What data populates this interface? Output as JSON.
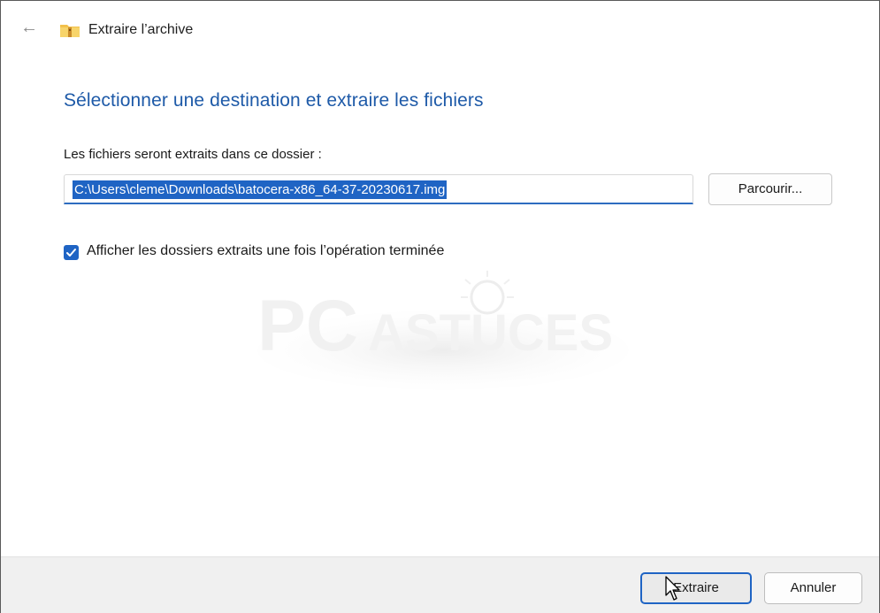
{
  "window": {
    "title": "Extraire l’archive",
    "back_icon": "arrow-left-icon",
    "app_icon": "zip-folder-icon"
  },
  "main": {
    "heading": "Sélectionner une destination et extraire les fichiers",
    "destination_label": "Les fichiers seront extraits dans ce dossier :",
    "destination_value": "C:\\Users\\cleme\\Downloads\\batocera-x86_64-37-20230617.img",
    "browse_label": "Parcourir...",
    "show_folders_label": "Afficher les dossiers extraits une fois l’opération terminée",
    "show_folders_checked": true
  },
  "watermark": {
    "text_main": "PC",
    "text_secondary": "ASTUCES"
  },
  "footer": {
    "extract_label": "Extraire",
    "cancel_label": "Annuler"
  },
  "colors": {
    "accent": "#1f64c4",
    "heading": "#1e5aa8",
    "footer_bg": "#f0f0f0"
  }
}
